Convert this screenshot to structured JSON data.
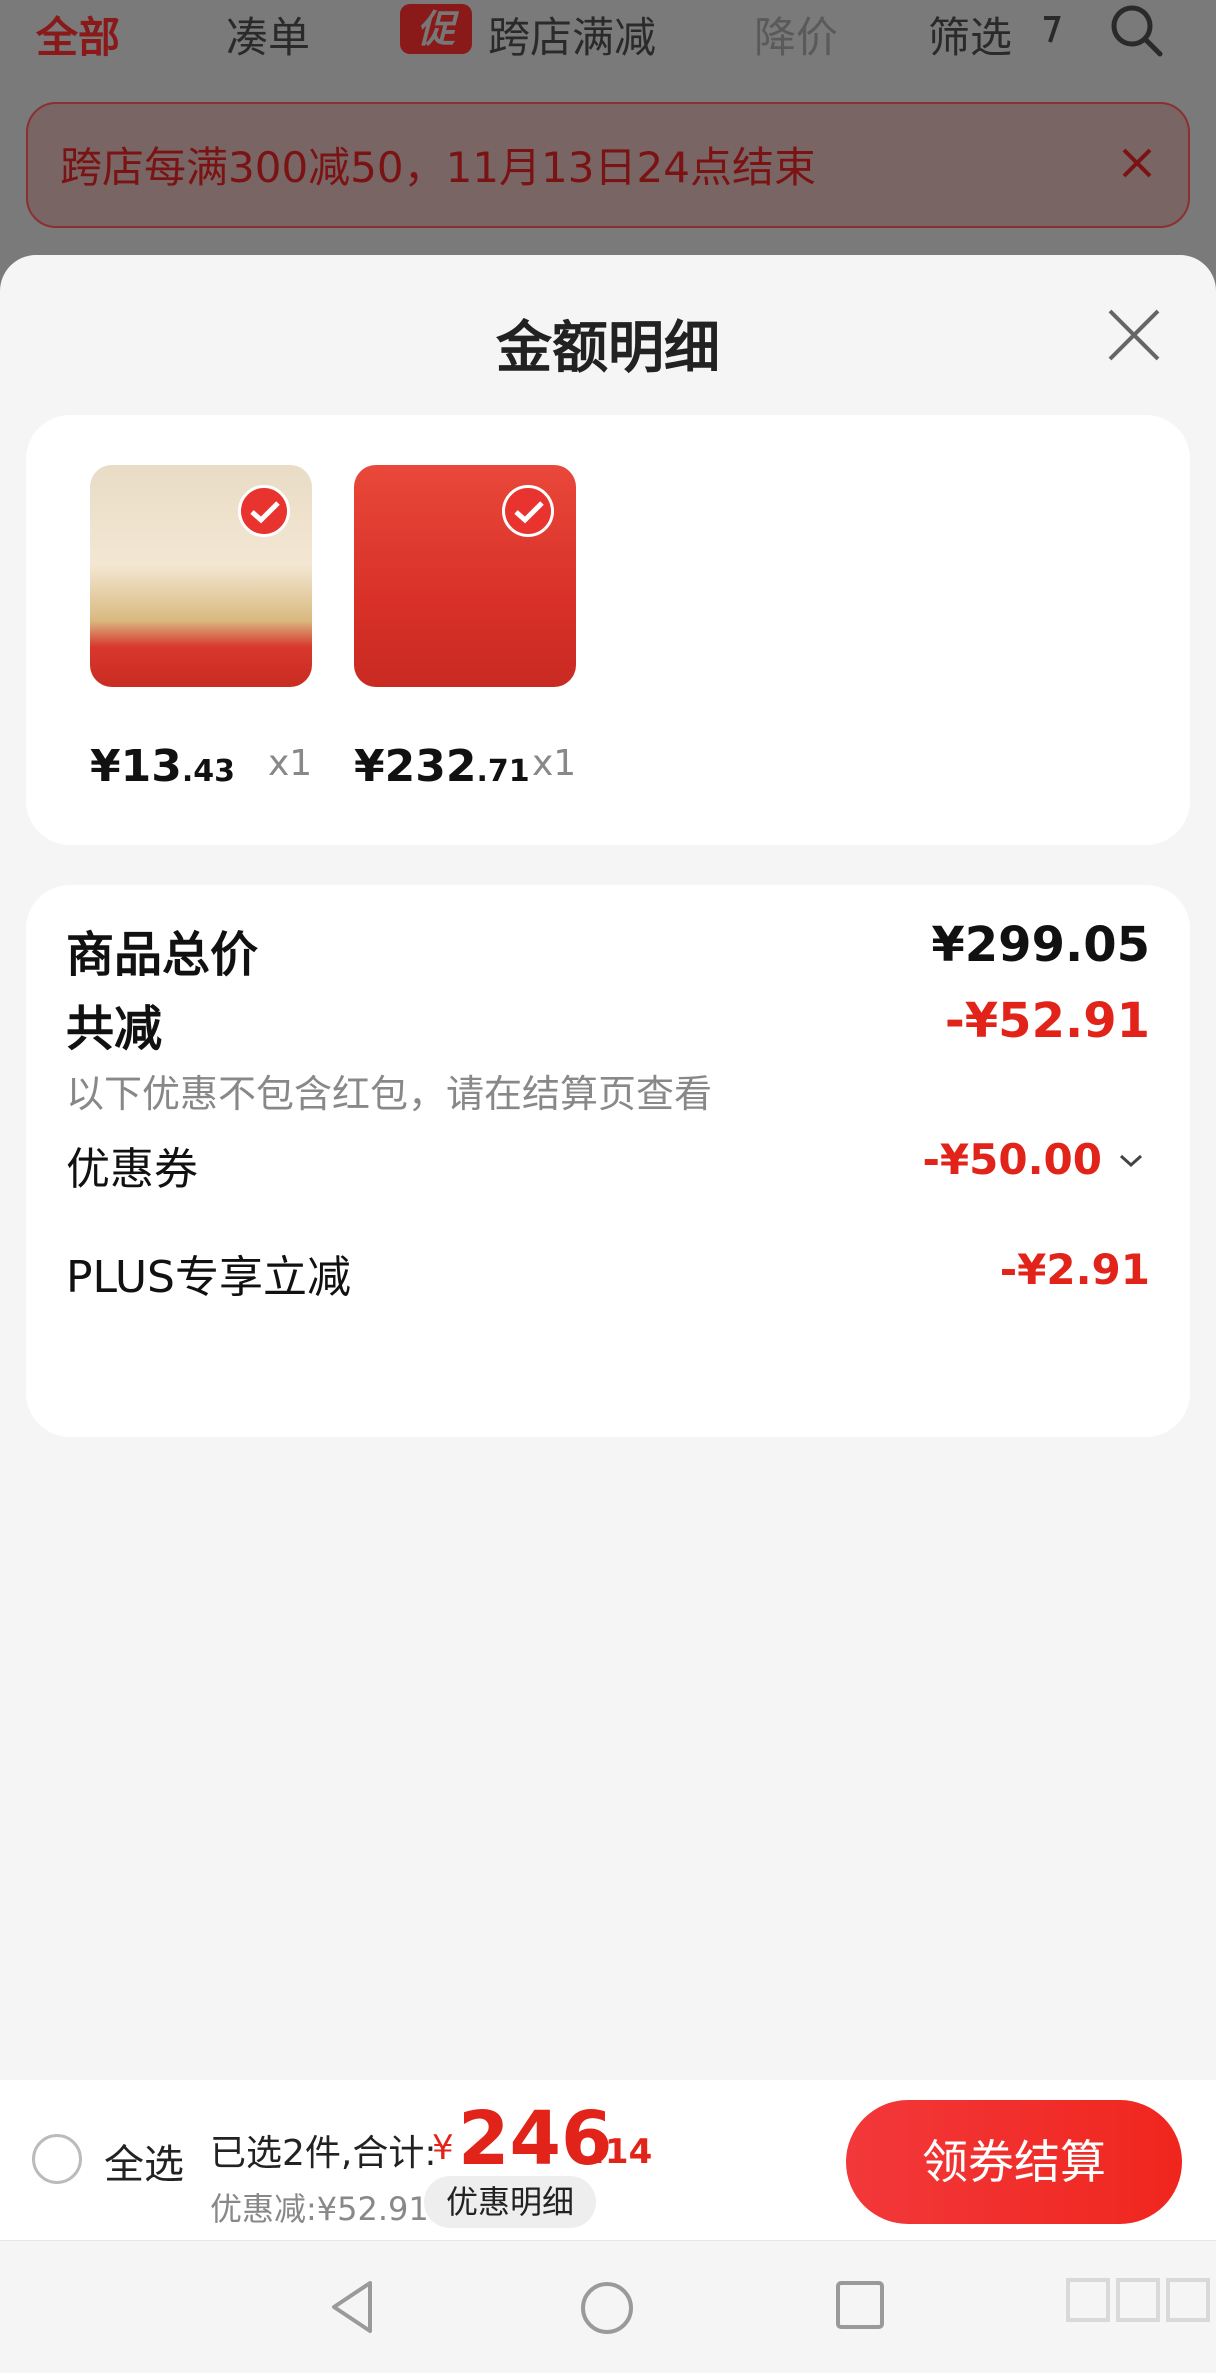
{
  "top_tabs": {
    "all": "全部",
    "bundle": "凑单",
    "promo_badge": "促",
    "cross_store": "跨店满减",
    "price_drop": "降价",
    "filter": "筛选"
  },
  "notice": {
    "text": "跨店每满300减50，11月13日24点结束"
  },
  "sheet": {
    "title": "金额明细"
  },
  "products": [
    {
      "price_int": "¥13",
      "price_dec": ".43",
      "qty": "x1"
    },
    {
      "price_int": "¥232",
      "price_dec": ".71",
      "qty": "x1"
    }
  ],
  "summary": {
    "total_label": "商品总价",
    "total_value": "¥299.05",
    "discount_label": "共减",
    "discount_value": "-¥52.91",
    "discount_note": "以下优惠不包含红包，请在结算页查看",
    "coupon_label": "优惠券",
    "coupon_value": "-¥50.00",
    "plus_label": "PLUS专享立减",
    "plus_value": "-¥2.91"
  },
  "bottom_bar": {
    "select_all": "全选",
    "selected_summary": "已选2件,合计:",
    "currency": "¥",
    "total_int": "246",
    "total_dec": ".14",
    "discount_text": "优惠减:¥52.91",
    "detail_button": "优惠明细",
    "checkout_button": "领券结算"
  },
  "colors": {
    "accent": "#e2231a",
    "button": "#f0261e",
    "background": "#f5f5f5"
  },
  "icons": [
    "filter-icon",
    "search-icon",
    "close-icon",
    "checkmark-icon",
    "chevron-down-icon",
    "nav-back-icon",
    "nav-home-icon",
    "nav-recent-icon"
  ]
}
